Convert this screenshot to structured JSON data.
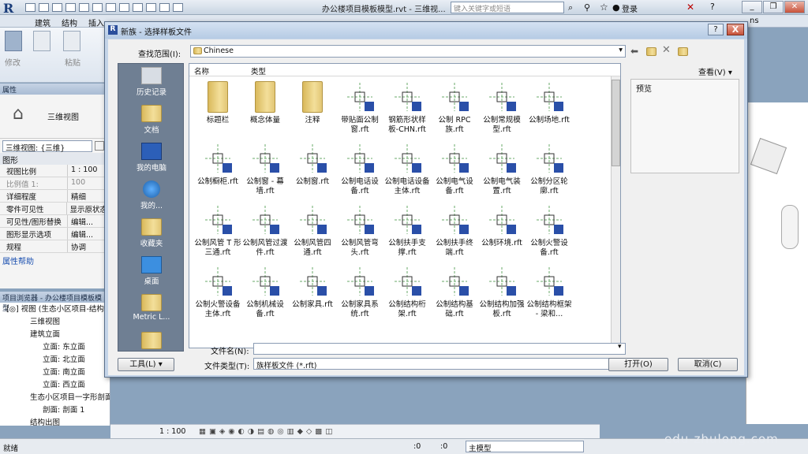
{
  "app": {
    "title": "办公楼项目模板模型.rvt - 三维视...",
    "search_placeholder": "键入关键字或短语",
    "login": "登录",
    "help": "?"
  },
  "ribbon": {
    "tabs": [
      "建筑",
      "结构",
      "插入"
    ],
    "modify_label": "修改",
    "paste_label": "粘贴",
    "ns_fragment": "ns"
  },
  "properties": {
    "header": "属性",
    "view_name": "三维视图",
    "type_selector": "三维视图: {三维}",
    "section": "图形",
    "rows": [
      [
        "视图比例",
        "1 : 100"
      ],
      [
        "比例值 1:",
        "100"
      ],
      [
        "详细程度",
        "精细"
      ],
      [
        "零件可见性",
        "显示原状态"
      ],
      [
        "可见性/图形替换",
        "编辑..."
      ],
      [
        "图形显示选项",
        "编辑..."
      ],
      [
        "规程",
        "协调"
      ]
    ],
    "help_link": "属性帮助"
  },
  "browser": {
    "header": "项目浏览器 - 办公楼项目模板模型",
    "items": [
      "[◎] 视图 (生态小区项目-结构)",
      "三维视图",
      "建筑立面",
      "立面: 东立面",
      "立面: 北立面",
      "立面: 南立面",
      "立面: 西立面",
      "生态小区项目一字形剖面",
      "剖面: 剖面 1",
      "结构出图"
    ]
  },
  "viewbar": {
    "scale": "1 : 100"
  },
  "status": {
    "ready": "就绪",
    "zero1": ":0",
    "zero2": ":0",
    "model": "主模型"
  },
  "dialog": {
    "title": "新族 - 选择样板文件",
    "help": "?",
    "close": "X",
    "lookin_label": "查找范围(I):",
    "lookin_value": "Chinese",
    "view_menu": "查看(V)",
    "col_name": "名称",
    "col_type": "类型",
    "preview_label": "预览",
    "places": [
      "历史记录",
      "文档",
      "我的电脑",
      "我的...",
      "收藏夹",
      "桌面",
      "Metric L..."
    ],
    "files": [
      [
        "标题栏",
        "folder"
      ],
      [
        "概念体量",
        "folder"
      ],
      [
        "注释",
        "folder"
      ],
      [
        "带贴面公制窗.rft",
        "rft"
      ],
      [
        "钢筋形状样板-CHN.rft",
        "rft"
      ],
      [
        "公制 RPC 族.rft",
        "rft"
      ],
      [
        "公制常规模型.rft",
        "rft"
      ],
      [
        "公制场地.rft",
        "rft"
      ],
      [
        "公制橱柜.rft",
        "rft"
      ],
      [
        "公制窗 - 幕墙.rft",
        "rft"
      ],
      [
        "公制窗.rft",
        "rft"
      ],
      [
        "公制电话设备.rft",
        "rft"
      ],
      [
        "公制电话设备主体.rft",
        "rft"
      ],
      [
        "公制电气设备.rft",
        "rft"
      ],
      [
        "公制电气装置.rft",
        "rft"
      ],
      [
        "公制分区轮廓.rft",
        "rft"
      ],
      [
        "公制风管 T 形三通.rft",
        "rft"
      ],
      [
        "公制风管过渡件.rft",
        "rft"
      ],
      [
        "公制风管四通.rft",
        "rft"
      ],
      [
        "公制风管弯头.rft",
        "rft"
      ],
      [
        "公制扶手支撑.rft",
        "rft"
      ],
      [
        "公制扶手终端.rft",
        "rft"
      ],
      [
        "公制环境.rft",
        "rft"
      ],
      [
        "公制火警设备.rft",
        "rft"
      ],
      [
        "公制火警设备主体.rft",
        "rft"
      ],
      [
        "公制机械设备.rft",
        "rft"
      ],
      [
        "公制家具.rft",
        "rft"
      ],
      [
        "公制家具系统.rft",
        "rft"
      ],
      [
        "公制结构桁架.rft",
        "rft"
      ],
      [
        "公制结构基础.rft",
        "rft"
      ],
      [
        "公制结构加强板.rft",
        "rft"
      ],
      [
        "公制结构框架 - 梁和...",
        "rft"
      ]
    ],
    "filename_label": "文件名(N):",
    "filename_value": "",
    "filetype_label": "文件类型(T):",
    "filetype_value": "族样板文件 (*.rft)",
    "tools_label": "工具(L)",
    "open_label": "打开(O)",
    "cancel_label": "取消(C)"
  },
  "watermark": "edu-zhulong.com",
  "colors": {
    "accent": "#1b3d7a",
    "places_bg": "#6f7f93",
    "dialog_frame": "#c4d4e8"
  }
}
